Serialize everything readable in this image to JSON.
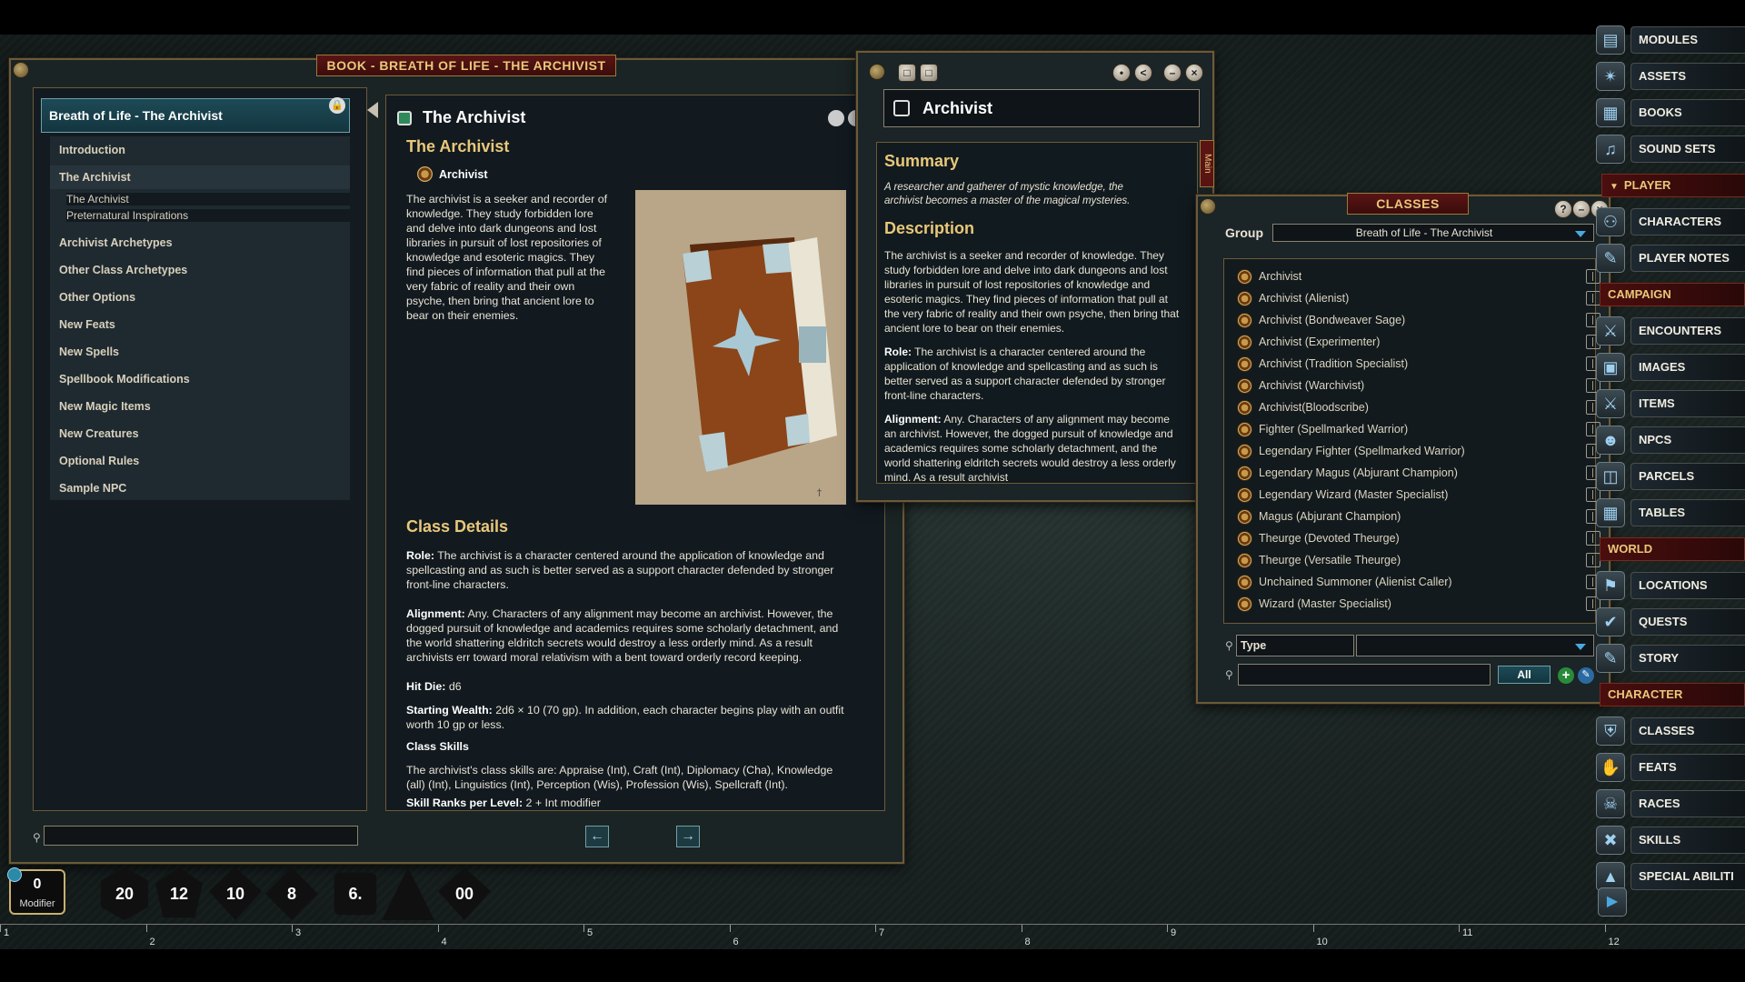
{
  "book_window": {
    "title": "BOOK - BREATH OF LIFE - THE ARCHIVIST",
    "toc_title": "Breath of Life - The Archivist",
    "toc": [
      {
        "label": "Introduction",
        "level": 0
      },
      {
        "label": "The Archivist",
        "level": 0
      },
      {
        "label": "The Archivist",
        "level": 1
      },
      {
        "label": "Preternatural Inspirations",
        "level": 1
      },
      {
        "label": "Archivist Archetypes",
        "level": 0
      },
      {
        "label": "Other Class Archetypes",
        "level": 0
      },
      {
        "label": "Other Options",
        "level": 0
      },
      {
        "label": "New Feats",
        "level": 0
      },
      {
        "label": "New Spells",
        "level": 0
      },
      {
        "label": "Spellbook Modifications",
        "level": 0
      },
      {
        "label": "New Magic Items",
        "level": 0
      },
      {
        "label": "New Creatures",
        "level": 0
      },
      {
        "label": "Optional Rules",
        "level": 0
      },
      {
        "label": "Sample NPC",
        "level": 0
      }
    ],
    "page": {
      "header": "The Archivist",
      "heading": "The Archivist",
      "link_label": "Archivist",
      "intro": "The archivist is a seeker and recorder of knowledge. They study forbidden lore and delve into dark dungeons and lost libraries in pursuit of lost repositories of knowledge and esoteric magics. They find pieces of information that pull at the very fabric of reality and their own psyche, then bring that ancient lore to bear on their enemies.",
      "class_details_heading": "Class Details",
      "role_label": "Role:",
      "role_text": " The archivist is a character centered around the application of knowledge and spellcasting and as such is better served as a support character defended by stronger front-line characters.",
      "alignment_label": "Alignment:",
      "alignment_text": " Any. Characters of any alignment may become an archivist. However, the dogged pursuit of knowledge and academics requires some scholarly detachment, and the world shattering eldritch secrets would destroy a less orderly mind. As a result archivists err toward moral relativism with a bent toward orderly record keeping.",
      "hitdie_label": "Hit Die:",
      "hitdie_text": " d6",
      "wealth_label": "Starting Wealth:",
      "wealth_text": " 2d6 × 10 (70 gp). In addition, each character begins play with an outfit worth 10 gp or less.",
      "skills_heading": "Class Skills",
      "skills_text": "The archivist's class skills are: Appraise (Int), Craft (Int), Diplomacy (Cha), Knowledge (all) (Int), Linguistics (Int), Perception (Wis), Profession (Wis), Spellcraft (Int).",
      "ranks_label": "Skill Ranks per Level:",
      "ranks_text": " 2 + Int modifier"
    }
  },
  "class_window": {
    "title": "Archivist",
    "tab": "Main",
    "summary_heading": "Summary",
    "summary_text": "A researcher and gatherer of mystic knowledge, the archivist becomes a master of the magical mysteries.",
    "description_heading": "Description",
    "description_text": "The archivist is a seeker and recorder of knowledge. They study forbidden lore and delve into dark dungeons and lost libraries in pursuit of lost repositories of knowledge and esoteric magics. They find pieces of information that pull at the very fabric of reality and their own psyche, then bring that ancient lore to bear on their enemies.",
    "role_label": "Role:",
    "role_text": " The archivist is a character centered around the application of knowledge and spellcasting and as such is better served as a support character defended by stronger front-line characters.",
    "alignment_label": "Alignment:",
    "alignment_text": " Any. Characters of any alignment may become an archivist. However, the dogged pursuit of knowledge and academics requires some scholarly detachment, and the world shattering eldritch secrets would destroy a less orderly mind. As a result archivist"
  },
  "classes_window": {
    "title": "CLASSES",
    "group_label": "Group",
    "group_value": "Breath of Life - The Archivist",
    "items": [
      "Archivist",
      "Archivist (Alienist)",
      "Archivist (Bondweaver Sage)",
      "Archivist (Experimenter)",
      "Archivist (Tradition Specialist)",
      "Archivist (Warchivist)",
      "Archivist(Bloodscribe)",
      "Fighter (Spellmarked Warrior)",
      "Legendary Fighter (Spellmarked Warrior)",
      "Legendary Magus (Abjurant Champion)",
      "Legendary Wizard (Master Specialist)",
      "Magus (Abjurant Champion)",
      "Theurge (Devoted Theurge)",
      "Theurge (Versatile Theurge)",
      "Unchained Summoner (Alienist Caller)",
      "Wizard (Master Specialist)"
    ],
    "filter_label": "Type",
    "all_button": "All"
  },
  "sidebar": {
    "top": [
      {
        "label": "MODULES",
        "icon": "folder-icon"
      },
      {
        "label": "ASSETS",
        "icon": "puzzle-icon"
      },
      {
        "label": "BOOKS",
        "icon": "books-icon"
      },
      {
        "label": "SOUND SETS",
        "icon": "music-icon"
      }
    ],
    "player_head": "PLAYER",
    "player": [
      {
        "label": "CHARACTERS",
        "icon": "characters-icon"
      },
      {
        "label": "PLAYER NOTES",
        "icon": "notes-icon"
      }
    ],
    "campaign_head": "CAMPAIGN",
    "campaign": [
      {
        "label": "ENCOUNTERS",
        "icon": "encounters-icon"
      },
      {
        "label": "IMAGES",
        "icon": "images-icon"
      },
      {
        "label": "ITEMS",
        "icon": "items-icon"
      },
      {
        "label": "NPCS",
        "icon": "npcs-icon"
      },
      {
        "label": "PARCELS",
        "icon": "parcels-icon"
      },
      {
        "label": "TABLES",
        "icon": "tables-icon"
      }
    ],
    "world_head": "WORLD",
    "world": [
      {
        "label": "LOCATIONS",
        "icon": "locations-icon"
      },
      {
        "label": "QUESTS",
        "icon": "quests-icon"
      },
      {
        "label": "STORY",
        "icon": "story-icon"
      }
    ],
    "character_head": "CHARACTER",
    "character": [
      {
        "label": "CLASSES",
        "icon": "classes-icon"
      },
      {
        "label": "FEATS",
        "icon": "feats-icon"
      },
      {
        "label": "RACES",
        "icon": "races-icon"
      },
      {
        "label": "SKILLS",
        "icon": "skills-icon"
      },
      {
        "label": "SPECIAL ABILITI",
        "icon": "abilities-icon"
      }
    ]
  },
  "modifier": {
    "value": "0",
    "label": "Modifier"
  },
  "dice": [
    "20",
    "12",
    "10",
    "8",
    "6.",
    "",
    "00"
  ],
  "ruler": [
    "1",
    "2",
    "3",
    "4",
    "5",
    "6",
    "7",
    "8",
    "9",
    "10",
    "11",
    "12"
  ],
  "colors": {
    "accent_gold": "#e8c879",
    "title_red": "#5a1414",
    "frame": "#6b5a3a"
  }
}
